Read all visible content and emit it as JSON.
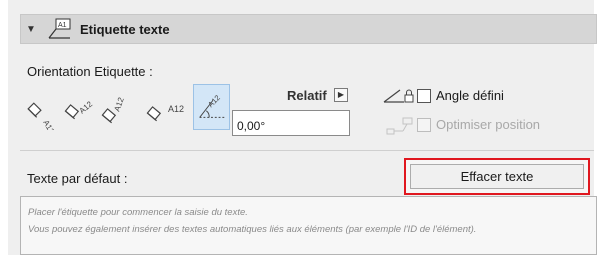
{
  "section": {
    "title": "Etiquette texte",
    "collapse_icon": "triangle-down-icon",
    "header_icon": "label-text-icon"
  },
  "orientation": {
    "label": "Orientation Etiquette :",
    "options": [
      {
        "name": "rotated-left",
        "text": "A12"
      },
      {
        "name": "rotated-diagonal",
        "text": "A12"
      },
      {
        "name": "rotated-up",
        "text": "A12"
      },
      {
        "name": "horizontal",
        "text": "A12"
      },
      {
        "name": "angled-selected",
        "text": "A12",
        "selected": true
      }
    ],
    "relatif_label": "Relatif",
    "angle_value": "0,00°"
  },
  "angle_defined": {
    "label": "Angle défini",
    "checked": false
  },
  "optimize_position": {
    "label": "Optimiser position",
    "checked": false,
    "disabled": true
  },
  "default_text": {
    "label": "Texte par défaut :",
    "clear_button": "Effacer texte",
    "placeholder_line1": "Placer l'étiquette pour commencer la saisie du texte.",
    "placeholder_line2": "Vous pouvez également insérer des textes automatiques liés aux éléments (par exemple l'ID de l'élément)."
  },
  "colors": {
    "highlight": "#e0171f",
    "selected_bg": "#d3e6f7"
  }
}
